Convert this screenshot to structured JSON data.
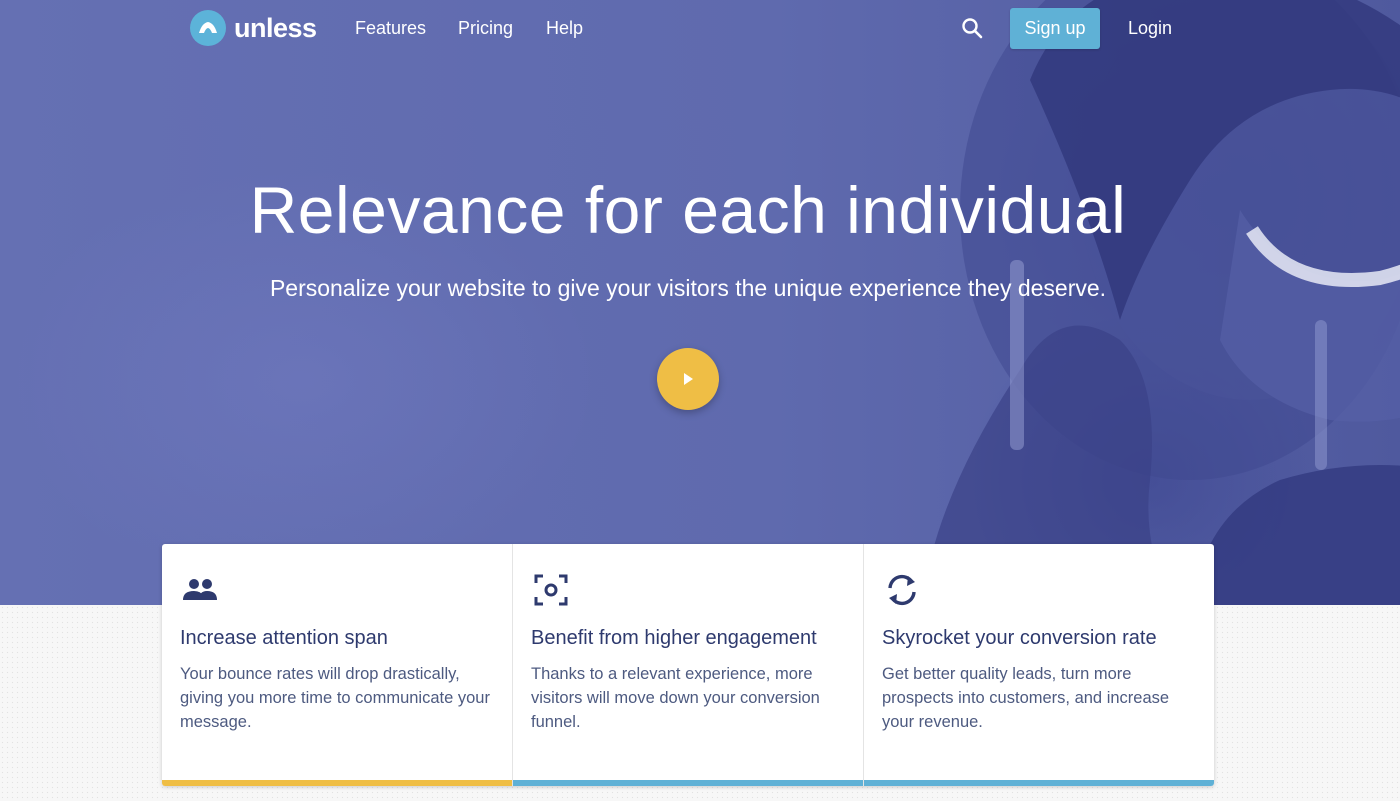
{
  "nav": {
    "brand": "unless",
    "links": [
      {
        "label": "Features"
      },
      {
        "label": "Pricing"
      },
      {
        "label": "Help"
      }
    ],
    "search_icon": "search-icon",
    "signup_label": "Sign up",
    "login_label": "Login"
  },
  "hero": {
    "title": "Relevance for each individual",
    "subtitle": "Personalize your website to give your visitors the unique experience they deserve.",
    "play_icon": "play-icon"
  },
  "features": [
    {
      "icon": "users-icon",
      "title": "Increase attention span",
      "text": "Your bounce rates will drop drastically, giving you more time to communicate your message.",
      "accent": "#efbe45"
    },
    {
      "icon": "focus-target-icon",
      "title": "Benefit from higher engagement",
      "text": "Thanks to a relevant experience, more visitors will move down your conversion funnel.",
      "accent": "#5fb1d6"
    },
    {
      "icon": "refresh-icon",
      "title": "Skyrocket your conversion rate",
      "text": "Get better quality leads, turn more prospects into customers, and increase your revenue.",
      "accent": "#5fb1d6"
    }
  ],
  "colors": {
    "hero_bg": "#5f6aae",
    "brand_blue": "#5fb1d6",
    "accent_yellow": "#efbe45",
    "card_title": "#2e3a6e"
  }
}
